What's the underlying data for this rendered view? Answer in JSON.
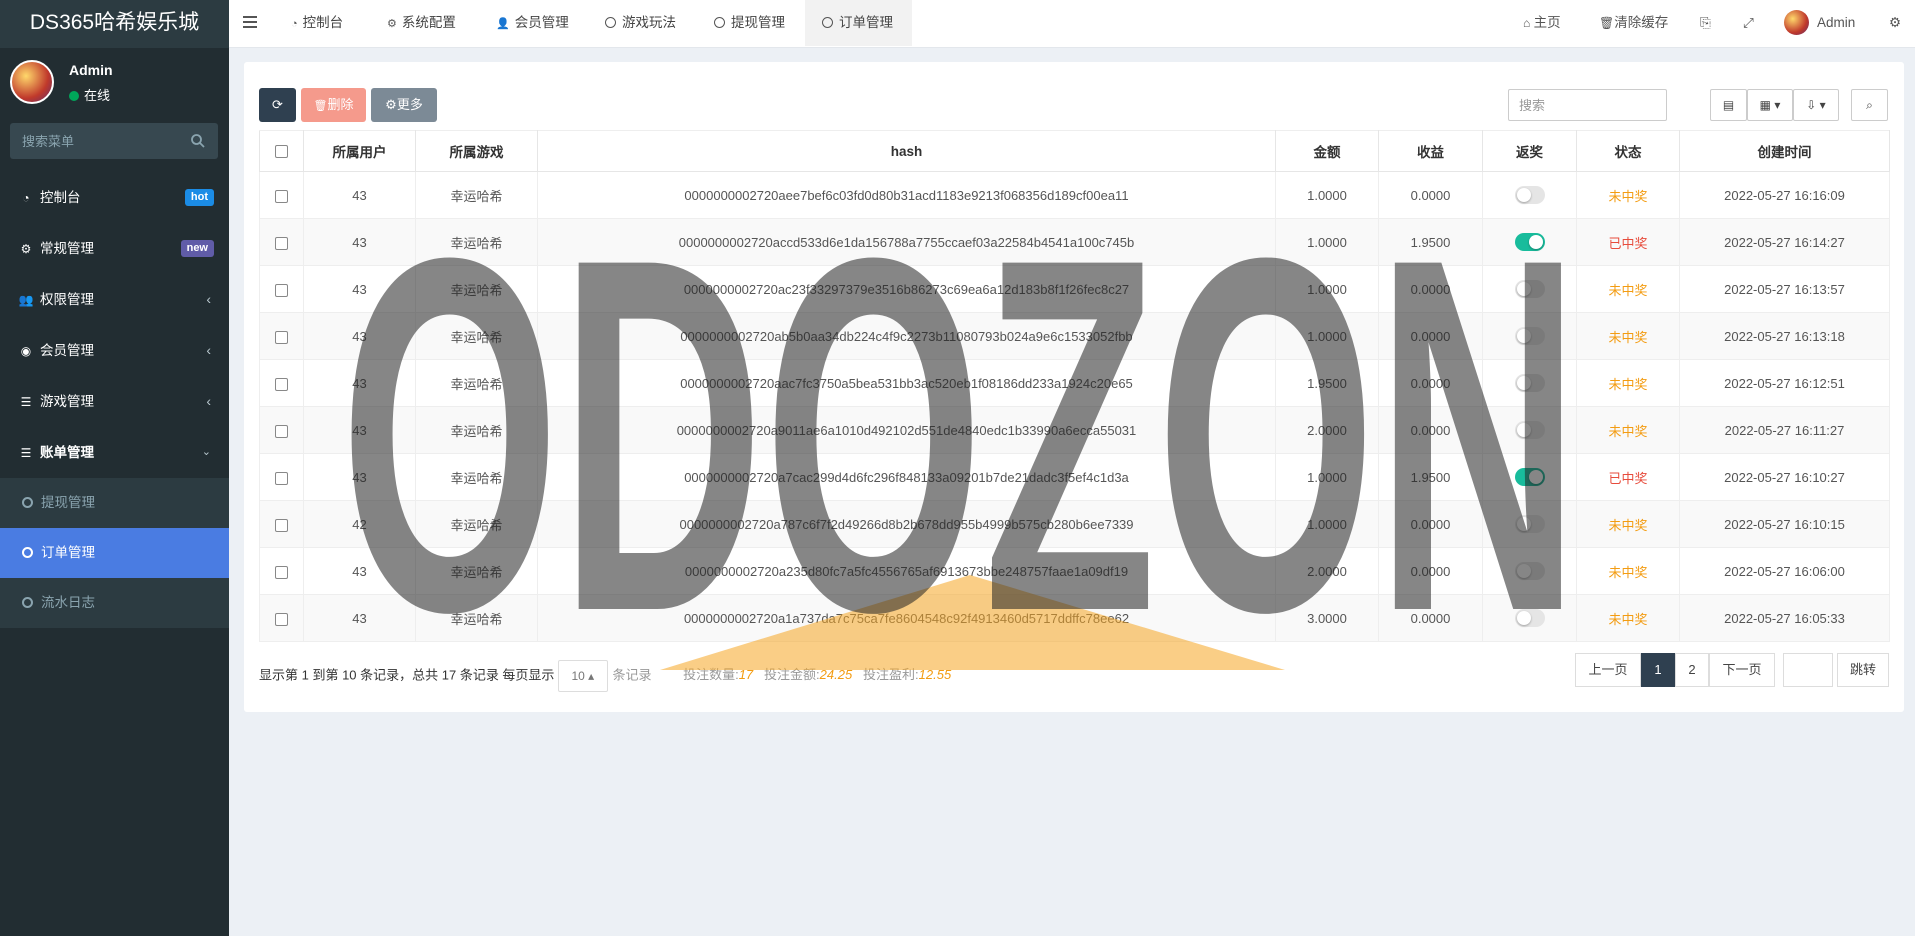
{
  "sidebar": {
    "brand": "DS365哈希娱乐城",
    "user": {
      "name": "Admin",
      "status": "在线"
    },
    "search_placeholder": "搜索菜单",
    "items": [
      {
        "label": "控制台",
        "icon": "dashboard-icon",
        "badge": "hot"
      },
      {
        "label": "常规管理",
        "icon": "cogs-icon",
        "badge": "new"
      },
      {
        "label": "权限管理",
        "icon": "group-icon"
      },
      {
        "label": "会员管理",
        "icon": "user-circle-icon"
      },
      {
        "label": "游戏管理",
        "icon": "list-icon"
      },
      {
        "label": "账单管理",
        "icon": "list-icon",
        "expanded": true
      }
    ],
    "subitems": [
      {
        "label": "提现管理"
      },
      {
        "label": "订单管理",
        "active": true
      },
      {
        "label": "流水日志"
      }
    ]
  },
  "topbar": {
    "tabs": [
      {
        "label": "控制台",
        "icon": "dashboard-icon"
      },
      {
        "label": "系统配置",
        "icon": "gear-icon"
      },
      {
        "label": "会员管理",
        "icon": "user-icon"
      },
      {
        "label": "游戏玩法",
        "icon": "circle-icon"
      },
      {
        "label": "提现管理",
        "icon": "circle-icon"
      },
      {
        "label": "订单管理",
        "icon": "circle-icon",
        "active": true
      }
    ],
    "right": {
      "home": "主页",
      "clear_cache": "清除缓存",
      "admin": "Admin"
    }
  },
  "toolbar": {
    "delete_label": "删除",
    "more_label": "更多",
    "search_placeholder": "搜索"
  },
  "table": {
    "headers": [
      "所属用户",
      "所属游戏",
      "hash",
      "金额",
      "收益",
      "返奖",
      "状态",
      "创建时间"
    ],
    "rows": [
      {
        "user": "43",
        "game": "幸运哈希",
        "hash": "0000000002720aee7bef6c03fd0d80b31acd1183e9213f068356d189cf00ea11",
        "amount": "1.0000",
        "profit": "0.0000",
        "payout": false,
        "status": "未中奖",
        "time": "2022-05-27 16:16:09"
      },
      {
        "user": "43",
        "game": "幸运哈希",
        "hash": "0000000002720accd533d6e1da156788a7755ccaef03a22584b4541a100c745b",
        "amount": "1.0000",
        "profit": "1.9500",
        "payout": true,
        "status": "已中奖",
        "time": "2022-05-27 16:14:27"
      },
      {
        "user": "43",
        "game": "幸运哈希",
        "hash": "0000000002720ac23f33297379e3516b86273c69ea6a12d183b8f1f26fec8c27",
        "amount": "1.0000",
        "profit": "0.0000",
        "payout": false,
        "status": "未中奖",
        "time": "2022-05-27 16:13:57"
      },
      {
        "user": "43",
        "game": "幸运哈希",
        "hash": "0000000002720ab5b0aa34db224c4f9c2273b11080793b024a9e6c1533052fbb",
        "amount": "1.0000",
        "profit": "0.0000",
        "payout": false,
        "status": "未中奖",
        "time": "2022-05-27 16:13:18"
      },
      {
        "user": "43",
        "game": "幸运哈希",
        "hash": "0000000002720aac7fc3750a5bea531bb3ac520eb1f08186dd233a1924c20e65",
        "amount": "1.9500",
        "profit": "0.0000",
        "payout": false,
        "status": "未中奖",
        "time": "2022-05-27 16:12:51"
      },
      {
        "user": "43",
        "game": "幸运哈希",
        "hash": "0000000002720a9011ae6a1010d492102d551de4840edc1b33990a6ecca55031",
        "amount": "2.0000",
        "profit": "0.0000",
        "payout": false,
        "status": "未中奖",
        "time": "2022-05-27 16:11:27"
      },
      {
        "user": "43",
        "game": "幸运哈希",
        "hash": "0000000002720a7cac299d4d6fc296f848133a09201b7de21dadc3f5ef4c1d3a",
        "amount": "1.0000",
        "profit": "1.9500",
        "payout": true,
        "status": "已中奖",
        "time": "2022-05-27 16:10:27"
      },
      {
        "user": "42",
        "game": "幸运哈希",
        "hash": "0000000002720a787c6f7f2d49266d8b2b678dd955b4999b575cb280b6ee7339",
        "amount": "1.0000",
        "profit": "0.0000",
        "payout": false,
        "status": "未中奖",
        "time": "2022-05-27 16:10:15"
      },
      {
        "user": "43",
        "game": "幸运哈希",
        "hash": "0000000002720a235d80fc7a5fc4556765af6913673bbe248757faae1a09df19",
        "amount": "2.0000",
        "profit": "0.0000",
        "payout": false,
        "status": "未中奖",
        "time": "2022-05-27 16:06:00"
      },
      {
        "user": "43",
        "game": "幸运哈希",
        "hash": "0000000002720a1a737da7c75ca7fe8604548c92f4913460d5717ddffc78ee62",
        "amount": "3.0000",
        "profit": "0.0000",
        "payout": false,
        "status": "未中奖",
        "time": "2022-05-27 16:05:33"
      }
    ]
  },
  "footer": {
    "range_text": "显示第 1 到第 10 条记录，总共 17 条记录 每页显示",
    "page_size": "10",
    "records_suffix": "条记录",
    "bet_count_label": "投注数量:",
    "bet_count": "17",
    "bet_amount_label": "投注金额:",
    "bet_amount": "24.25",
    "bet_profit_label": "投注盈利:",
    "bet_profit": "12.55",
    "prev": "上一页",
    "pages": [
      "1",
      "2"
    ],
    "current_page": "1",
    "next": "下一页",
    "jump": "跳转"
  },
  "watermark": {
    "text": "ODOZON"
  },
  "colors": {
    "sidebar_bg": "#222d32",
    "active_blue": "#4a7ce2",
    "lose_orange": "#f39c12",
    "win_red": "#e74c3c",
    "switch_on": "#18bc9c"
  }
}
